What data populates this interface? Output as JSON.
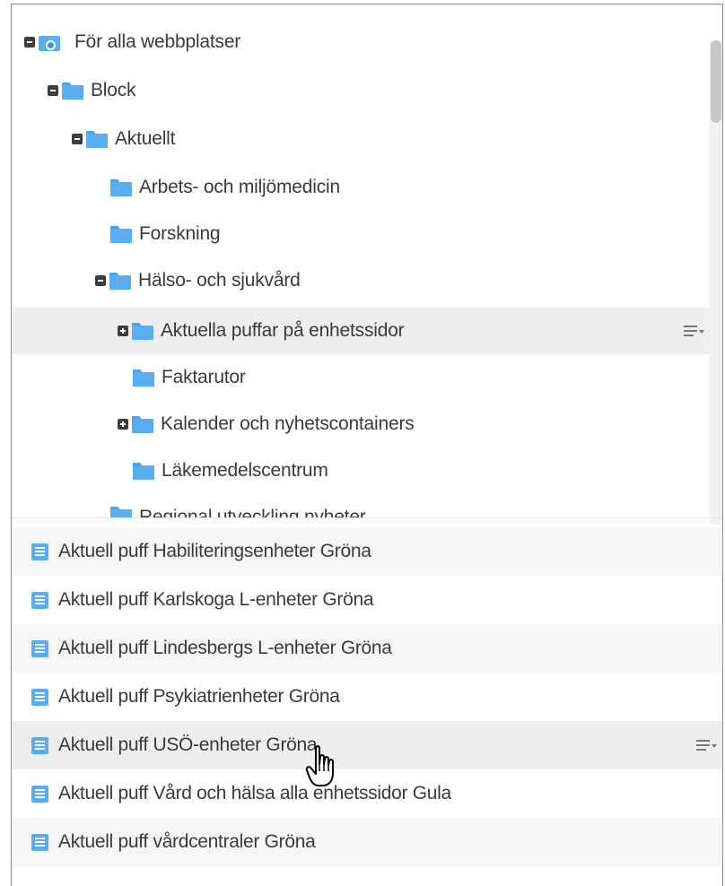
{
  "tree": {
    "items": [
      {
        "label": "För alla webbplatser",
        "icon": "site-icon",
        "toggle": "collapse"
      },
      {
        "label": "Block",
        "icon": "folder-icon",
        "toggle": "collapse"
      },
      {
        "label": "Aktuellt",
        "icon": "folder-icon",
        "toggle": "collapse"
      },
      {
        "label": "Arbets- och miljömedicin",
        "icon": "folder-icon",
        "toggle": "none"
      },
      {
        "label": "Forskning",
        "icon": "folder-icon",
        "toggle": "none"
      },
      {
        "label": "Hälso- och sjukvård",
        "icon": "folder-icon",
        "toggle": "collapse"
      },
      {
        "label": "Aktuella puffar på enhetssidor",
        "icon": "folder-icon",
        "toggle": "expand",
        "hovered": true
      },
      {
        "label": "Faktarutor",
        "icon": "folder-icon",
        "toggle": "none"
      },
      {
        "label": "Kalender och nyhetscontainers",
        "icon": "folder-icon",
        "toggle": "expand"
      },
      {
        "label": "Läkemedelscentrum",
        "icon": "folder-icon",
        "toggle": "none"
      },
      {
        "label": "Regional utveckling nyheter",
        "icon": "folder-icon",
        "toggle": "none",
        "clipped": true
      }
    ]
  },
  "content_list": {
    "items": [
      {
        "label": "Aktuell puff Habiliteringsenheter Gröna",
        "icon": "document-icon"
      },
      {
        "label": "Aktuell puff Karlskoga L-enheter Gröna",
        "icon": "document-icon"
      },
      {
        "label": "Aktuell puff Lindesbergs L-enheter Gröna",
        "icon": "document-icon"
      },
      {
        "label": "Aktuell puff Psykiatrienheter Gröna",
        "icon": "document-icon"
      },
      {
        "label": "Aktuell puff USÖ-enheter Gröna",
        "icon": "document-icon",
        "hovered": true
      },
      {
        "label": "Aktuell puff Vård och hälsa alla enhetssidor Gula",
        "icon": "document-icon"
      },
      {
        "label": "Aktuell puff vårdcentraler Gröna",
        "icon": "document-icon"
      }
    ]
  },
  "colors": {
    "folder": "#5aaef0",
    "hover_row": "#eeeeee",
    "text": "#3a3a3a"
  }
}
